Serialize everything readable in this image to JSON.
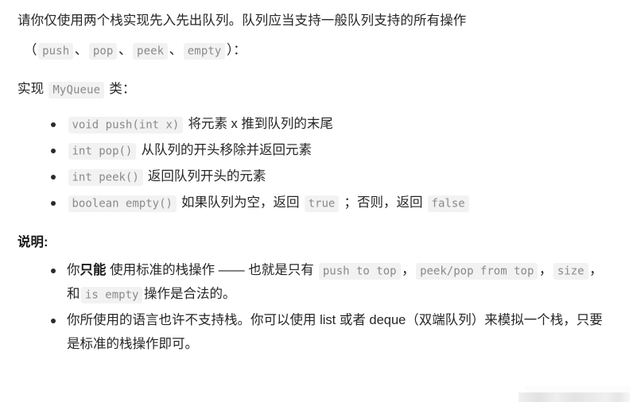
{
  "document": {
    "intro": {
      "line1_pre": "请你仅使用两个栈实现先入先出队列。队列应当支持一般队列支持的所有操作",
      "line2_open": "（",
      "code_push": "push",
      "sep1": "、",
      "code_pop": "pop",
      "sep2": "、",
      "code_peek": "peek",
      "sep3": "、",
      "code_empty": "empty",
      "line2_close": "）：",
      "implement_pre": "实现",
      "code_class": "MyQueue",
      "implement_post": "类："
    },
    "api_list": [
      {
        "code": "void push(int x)",
        "text": "将元素 x 推到队列的末尾"
      },
      {
        "code": "int pop()",
        "text": "从队列的开头移除并返回元素"
      },
      {
        "code": "int peek()",
        "text": "返回队列开头的元素"
      },
      {
        "code": "boolean empty()",
        "text_pre": "如果队列为空，返回",
        "code_true": "true",
        "text_mid": "；否则，返回",
        "code_false": "false"
      }
    ],
    "notes_heading": "说明:",
    "notes": [
      {
        "pre": "你",
        "bold": "只能",
        "mid": "使用标准的栈操作 —— 也就是只有",
        "code_a": "push to top",
        "comma1": "，",
        "code_b": "peek/pop from top",
        "comma2": "，",
        "code_c": "size",
        "comma3": "，和",
        "code_d": "is empty",
        "tail": "操作是合法的。"
      },
      {
        "text": "你所使用的语言也许不支持栈。你可以使用 list 或者 deque（双端队列）来模拟一个栈，只要是标准的栈操作即可。"
      }
    ]
  },
  "theme": {
    "background": "#ffffff",
    "text_color": "#262626",
    "code_bg": "#f2f2f2",
    "code_fg": "#8a8a8a",
    "bullet_color": "#2b2b2b"
  }
}
